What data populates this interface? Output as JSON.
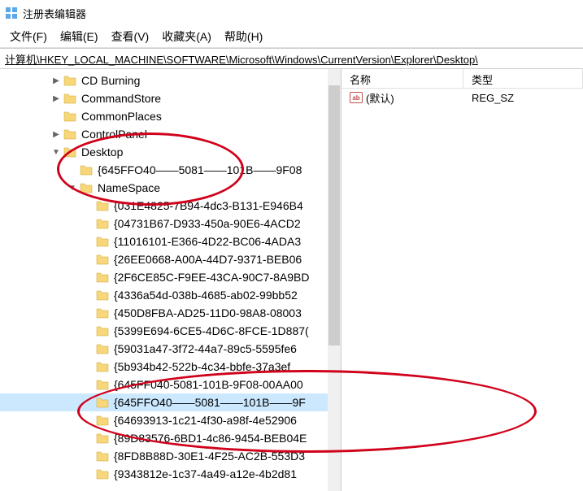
{
  "window": {
    "title": "注册表编辑器"
  },
  "menu": {
    "file": "文件(F)",
    "edit": "编辑(E)",
    "view": "查看(V)",
    "favorites": "收藏夹(A)",
    "help": "帮助(H)"
  },
  "address": {
    "path": "计算机\\HKEY_LOCAL_MACHINE\\SOFTWARE\\Microsoft\\Windows\\CurrentVersion\\Explorer\\Desktop\\"
  },
  "tree": {
    "top": [
      {
        "label": "CD Burning",
        "expander": ">",
        "indent": 60
      },
      {
        "label": "CommandStore",
        "expander": ">",
        "indent": 60
      },
      {
        "label": "CommonPlaces",
        "expander": "",
        "indent": 60
      },
      {
        "label": "ControlPanel",
        "expander": ">",
        "indent": 60
      },
      {
        "label": "Desktop",
        "expander": "v",
        "indent": 60
      },
      {
        "label": "{645FFO40——5081——101B——9F08",
        "expander": "",
        "indent": 80
      },
      {
        "label": "NameSpace",
        "expander": "v",
        "indent": 80
      }
    ],
    "guids": [
      "{031E4825-7B94-4dc3-B131-E946B4",
      "{04731B67-D933-450a-90E6-4ACD2",
      "{11016101-E366-4D22-BC06-4ADA3",
      "{26EE0668-A00A-44D7-9371-BEB06",
      "{2F6CE85C-F9EE-43CA-90C7-8A9BD",
      "{4336a54d-038b-4685-ab02-99bb52",
      "{450D8FBA-AD25-11D0-98A8-08003",
      "{5399E694-6CE5-4D6C-8FCE-1D887(",
      "{59031a47-3f72-44a7-89c5-5595fe6",
      "{5b934b42-522b-4c34-bbfe-37a3ef",
      "{645FF040-5081-101B-9F08-00AA00",
      "{645FFO40——5081——101B——9F",
      "{64693913-1c21-4f30-a98f-4e52906",
      "{89D83576-6BD1-4c86-9454-BEB04E",
      "{8FD8B88D-30E1-4F25-AC2B-553D3",
      "{9343812e-1c37-4a49-a12e-4b2d81"
    ],
    "selectedIndex": 11
  },
  "list": {
    "headers": {
      "name": "名称",
      "type": "类型"
    },
    "rows": [
      {
        "icon": "ab",
        "name": "(默认)",
        "type": "REG_SZ"
      }
    ]
  }
}
